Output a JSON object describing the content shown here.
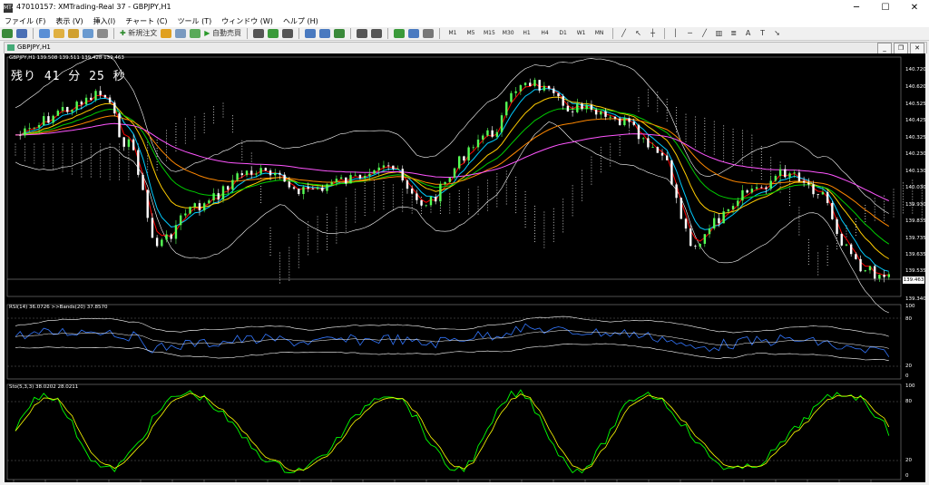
{
  "window": {
    "title": "47010157: XMTrading-Real 37 - GBPJPY,H1",
    "logo": "MT4"
  },
  "menu": [
    "ファイル (F)",
    "表示 (V)",
    "挿入(I)",
    "チャート (C)",
    "ツール (T)",
    "ウィンドウ (W)",
    "ヘルプ (H)"
  ],
  "toolbar": {
    "new_order": "新規注文",
    "auto_trading": "自動売買",
    "timeframes": [
      "M1",
      "M5",
      "M15",
      "M30",
      "H1",
      "H4",
      "D1",
      "W1",
      "MN"
    ],
    "text_tool": "A"
  },
  "chart_window": {
    "title": "GBPJPY,H1"
  },
  "main_panel": {
    "header": "GBPJPY,H1  139.508 139.511 139.428 139.463",
    "countdown": "残り 41 分 25 秒",
    "current_price": "139.463",
    "price_labels": [
      "140.720",
      "140.620",
      "140.525",
      "140.425",
      "140.325",
      "140.230",
      "140.130",
      "140.030",
      "139.930",
      "139.835",
      "139.735",
      "139.635",
      "139.535",
      "139.340"
    ]
  },
  "rsi_panel": {
    "header": "RSI(14) 36.0726   >>Bands(20) 37.8570",
    "levels": [
      "100",
      "80",
      "20",
      "0"
    ]
  },
  "stoch_panel": {
    "header": "Sto(5,3,3) 38.0202 28.0211",
    "levels": [
      "100",
      "80",
      "20",
      "0"
    ]
  },
  "colors": {
    "candle_up": "#55ff55",
    "candle_down": "#ffffff",
    "ma_red": "#ff0000",
    "ma_cyan": "#00ccff",
    "ma_yellow": "#ffcc00",
    "ma_green": "#00cc00",
    "ma_orange": "#ff8800",
    "ma_magenta": "#ff55ff",
    "bands": "#ffffff",
    "rsi": "#3377ff",
    "stoch_main": "#00ff00",
    "stoch_signal": "#ffff00"
  }
}
